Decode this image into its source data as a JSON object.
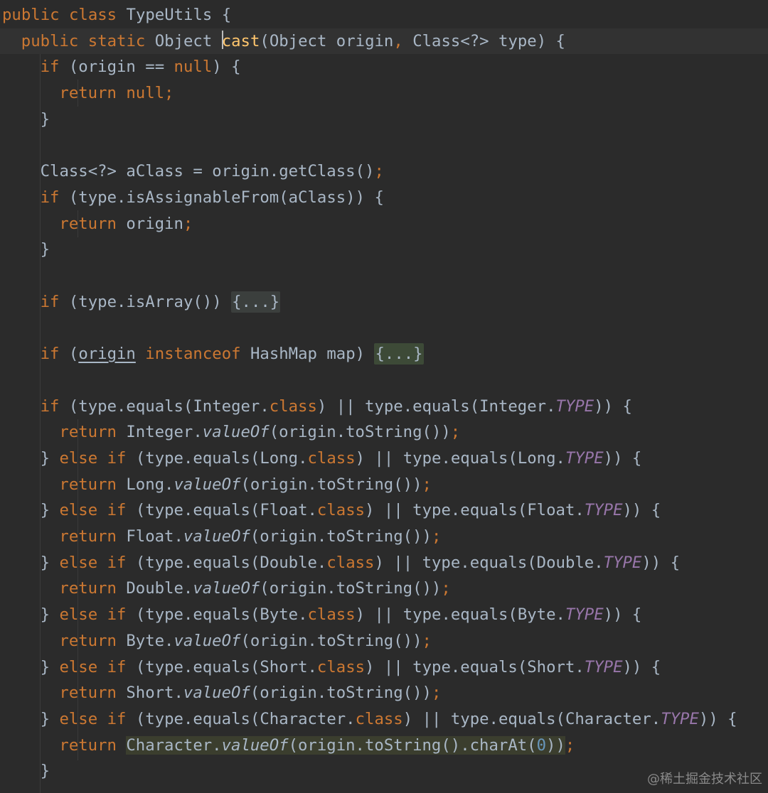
{
  "editor": {
    "colors": {
      "background": "#2b2b2b",
      "keyword": "#cc7832",
      "method_decl": "#ffc66d",
      "default_text": "#a9b7c6",
      "static_field": "#9876aa",
      "number": "#6897bb"
    },
    "hint_icon": "lightbulb-icon",
    "lines": [
      [
        [
          "kw",
          "public class "
        ],
        [
          "txt",
          "TypeUtils {"
        ]
      ],
      [
        [
          "kw",
          "public static "
        ],
        [
          "txt",
          "Object "
        ],
        [
          "fn",
          "cast"
        ],
        [
          "txt",
          "(Object origin"
        ],
        [
          "kw",
          ", "
        ],
        [
          "txt",
          "Class<?> type) {"
        ]
      ],
      [
        [
          "kw",
          "if "
        ],
        [
          "txt",
          "(origin == "
        ],
        [
          "kw",
          "null"
        ],
        [
          "txt",
          ") {"
        ]
      ],
      [
        [
          "kw",
          "return null;"
        ]
      ],
      [
        [
          "txt",
          "}"
        ]
      ],
      [],
      [
        [
          "txt",
          "Class<?> aClass = origin.getClass()"
        ],
        [
          "kw",
          ";"
        ]
      ],
      [
        [
          "kw",
          "if "
        ],
        [
          "txt",
          "(type.isAssignableFrom(aClass)) {"
        ]
      ],
      [
        [
          "kw",
          "return "
        ],
        [
          "txt",
          "origin"
        ],
        [
          "kw",
          ";"
        ]
      ],
      [
        [
          "txt",
          "}"
        ]
      ],
      [],
      [
        [
          "kw",
          "if "
        ],
        [
          "txt",
          "(type.isArray()) "
        ],
        [
          "fold",
          "{...}"
        ]
      ],
      [],
      [
        [
          "kw",
          "if "
        ],
        [
          "txt",
          "("
        ],
        [
          "und",
          "origin"
        ],
        [
          "txt",
          " "
        ],
        [
          "kw",
          "instanceof "
        ],
        [
          "txt",
          "HashMap map) "
        ],
        [
          "foldhl",
          "{...}"
        ]
      ],
      [],
      [
        [
          "kw",
          "if "
        ],
        [
          "txt",
          "(type.equals(Integer."
        ],
        [
          "kw",
          "class"
        ],
        [
          "txt",
          ") || type.equals(Integer."
        ],
        [
          "it",
          "TYPE"
        ],
        [
          "txt",
          ")) {"
        ]
      ],
      [
        [
          "kw",
          "return "
        ],
        [
          "txt",
          "Integer."
        ],
        [
          "itd",
          "valueOf"
        ],
        [
          "txt",
          "(origin.toString())"
        ],
        [
          "kw",
          ";"
        ]
      ],
      [
        [
          "txt",
          "} "
        ],
        [
          "kw",
          "else if "
        ],
        [
          "txt",
          "(type.equals(Long."
        ],
        [
          "kw",
          "class"
        ],
        [
          "txt",
          ") || type.equals(Long."
        ],
        [
          "it",
          "TYPE"
        ],
        [
          "txt",
          ")) {"
        ]
      ],
      [
        [
          "kw",
          "return "
        ],
        [
          "txt",
          "Long."
        ],
        [
          "itd",
          "valueOf"
        ],
        [
          "txt",
          "(origin.toString())"
        ],
        [
          "kw",
          ";"
        ]
      ],
      [
        [
          "txt",
          "} "
        ],
        [
          "kw",
          "else if "
        ],
        [
          "txt",
          "(type.equals(Float."
        ],
        [
          "kw",
          "class"
        ],
        [
          "txt",
          ") || type.equals(Float."
        ],
        [
          "it",
          "TYPE"
        ],
        [
          "txt",
          ")) {"
        ]
      ],
      [
        [
          "kw",
          "return "
        ],
        [
          "txt",
          "Float."
        ],
        [
          "itd",
          "valueOf"
        ],
        [
          "txt",
          "(origin.toString())"
        ],
        [
          "kw",
          ";"
        ]
      ],
      [
        [
          "txt",
          "} "
        ],
        [
          "kw",
          "else if "
        ],
        [
          "txt",
          "(type.equals(Double."
        ],
        [
          "kw",
          "class"
        ],
        [
          "txt",
          ") || type.equals(Double."
        ],
        [
          "it",
          "TYPE"
        ],
        [
          "txt",
          ")) {"
        ]
      ],
      [
        [
          "kw",
          "return "
        ],
        [
          "txt",
          "Double."
        ],
        [
          "itd",
          "valueOf"
        ],
        [
          "txt",
          "(origin.toString())"
        ],
        [
          "kw",
          ";"
        ]
      ],
      [
        [
          "txt",
          "} "
        ],
        [
          "kw",
          "else if "
        ],
        [
          "txt",
          "(type.equals(Byte."
        ],
        [
          "kw",
          "class"
        ],
        [
          "txt",
          ") || type.equals(Byte."
        ],
        [
          "it",
          "TYPE"
        ],
        [
          "txt",
          ")) {"
        ]
      ],
      [
        [
          "kw",
          "return "
        ],
        [
          "txt",
          "Byte."
        ],
        [
          "itd",
          "valueOf"
        ],
        [
          "txt",
          "(origin.toString())"
        ],
        [
          "kw",
          ";"
        ]
      ],
      [
        [
          "txt",
          "} "
        ],
        [
          "kw",
          "else if "
        ],
        [
          "txt",
          "(type.equals(Short."
        ],
        [
          "kw",
          "class"
        ],
        [
          "txt",
          ") || type.equals(Short."
        ],
        [
          "it",
          "TYPE"
        ],
        [
          "txt",
          ")) {"
        ]
      ],
      [
        [
          "kw",
          "return "
        ],
        [
          "txt",
          "Short."
        ],
        [
          "itd",
          "valueOf"
        ],
        [
          "txt",
          "(origin.toString())"
        ],
        [
          "kw",
          ";"
        ]
      ],
      [
        [
          "txt",
          "} "
        ],
        [
          "kw",
          "else if "
        ],
        [
          "txt",
          "(type.equals(Character."
        ],
        [
          "kw",
          "class"
        ],
        [
          "txt",
          ") || type.equals(Character."
        ],
        [
          "it",
          "TYPE"
        ],
        [
          "txt",
          ")) {"
        ]
      ],
      [
        [
          "kw",
          "return "
        ],
        [
          "hl_txt",
          "Character."
        ],
        [
          "hl_itd",
          "valueOf"
        ],
        [
          "hl_txt",
          "(origin.toString().charAt("
        ],
        [
          "hl_num",
          "0"
        ],
        [
          "hl_txt",
          "))"
        ],
        [
          "kw",
          ";"
        ]
      ],
      [
        [
          "txt",
          "}"
        ]
      ]
    ]
  },
  "watermark": "@稀土掘金技术社区"
}
